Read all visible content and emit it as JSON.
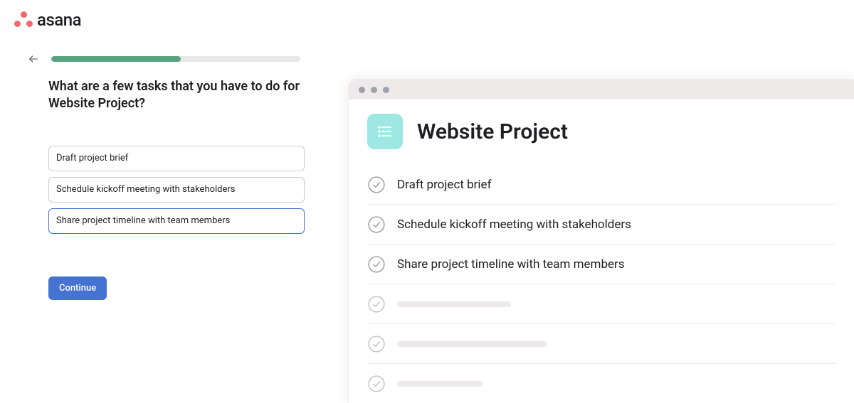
{
  "brand": {
    "name": "asana"
  },
  "progress": {
    "percent": 52
  },
  "form": {
    "prompt": "What are a few tasks that you have to do for Website Project?",
    "tasks": [
      "Draft project brief",
      "Schedule kickoff meeting with stakeholders",
      "Share project timeline with team members"
    ],
    "continue_label": "Continue"
  },
  "preview": {
    "project_title": "Website Project",
    "tasks": [
      "Draft project brief",
      "Schedule kickoff meeting with stakeholders",
      "Share project timeline with team members"
    ],
    "placeholder_rows": 3
  },
  "colors": {
    "accent": "#4573d2",
    "progress": "#5da283",
    "project_icon_bg": "#9ee7e3",
    "asana_dot": "#f06a6a"
  }
}
